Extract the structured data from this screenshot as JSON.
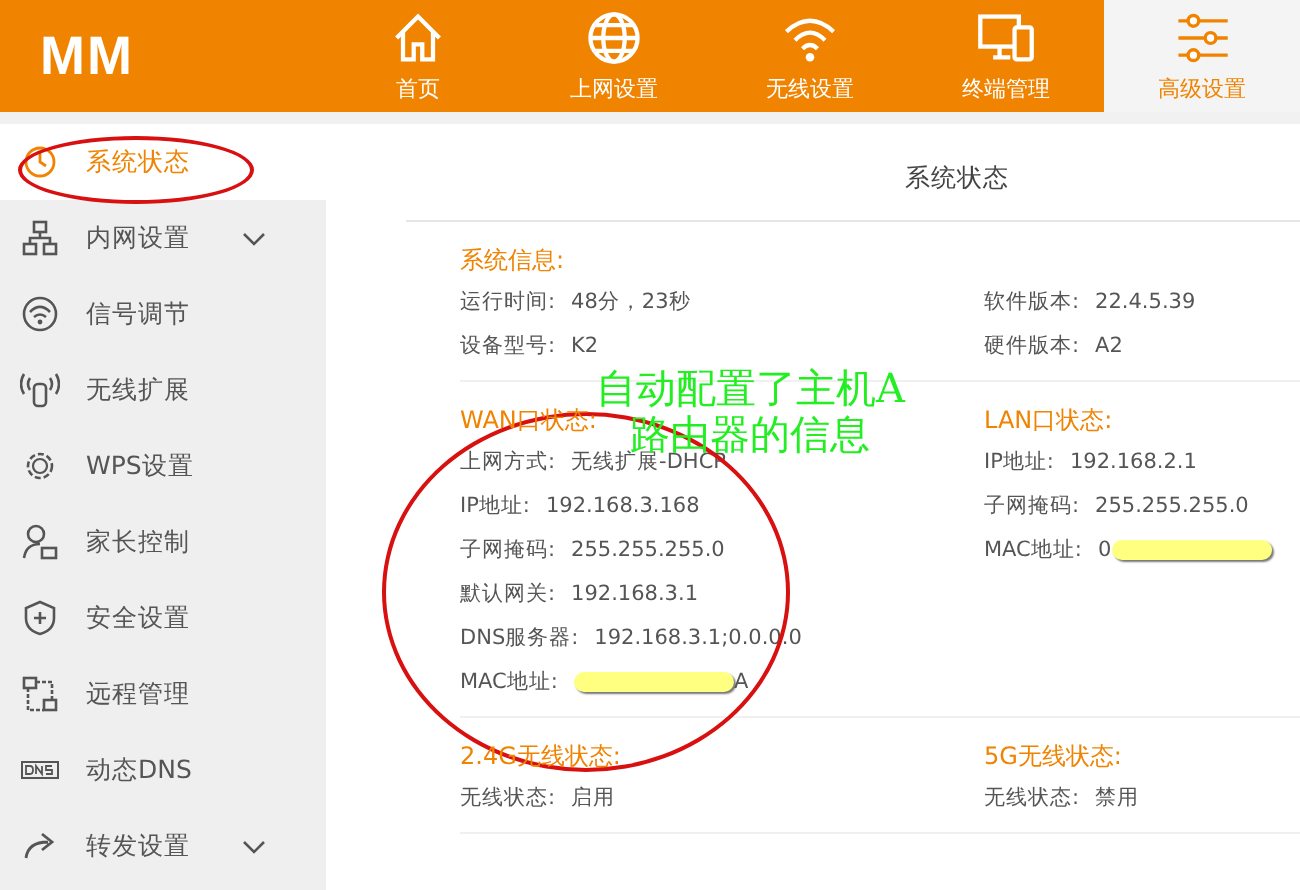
{
  "logo": "MM",
  "nav": [
    {
      "label": "首页",
      "selected": false
    },
    {
      "label": "上网设置",
      "selected": false
    },
    {
      "label": "无线设置",
      "selected": false
    },
    {
      "label": "终端管理",
      "selected": false
    },
    {
      "label": "高级设置",
      "selected": true
    }
  ],
  "sidebar": {
    "items": [
      {
        "label": "系统状态",
        "selected": true,
        "expandable": false
      },
      {
        "label": "内网设置",
        "selected": false,
        "expandable": true
      },
      {
        "label": "信号调节",
        "selected": false,
        "expandable": false
      },
      {
        "label": "无线扩展",
        "selected": false,
        "expandable": false
      },
      {
        "label": "WPS设置",
        "selected": false,
        "expandable": false
      },
      {
        "label": "家长控制",
        "selected": false,
        "expandable": false
      },
      {
        "label": "安全设置",
        "selected": false,
        "expandable": false
      },
      {
        "label": "远程管理",
        "selected": false,
        "expandable": false
      },
      {
        "label": "动态DNS",
        "selected": false,
        "expandable": false
      },
      {
        "label": "转发设置",
        "selected": false,
        "expandable": true
      }
    ]
  },
  "page_title": "系统状态",
  "sections": [
    {
      "columns": [
        {
          "heading": "系统信息:",
          "rows": [
            {
              "label": "运行时间:",
              "value": "48分，23秒"
            },
            {
              "label": "设备型号:",
              "value": "K2"
            }
          ]
        },
        {
          "rows": [
            {
              "label": "软件版本:",
              "value": "22.4.5.39"
            },
            {
              "label": "硬件版本:",
              "value": "A2"
            }
          ]
        }
      ]
    },
    {
      "columns": [
        {
          "heading": "WAN口状态:",
          "rows": [
            {
              "label": "上网方式:",
              "value": "无线扩展-DHCP"
            },
            {
              "label": "IP地址:",
              "value": "192.168.3.168"
            },
            {
              "label": "子网掩码:",
              "value": "255.255.255.0"
            },
            {
              "label": "默认网关:",
              "value": "192.168.3.1"
            },
            {
              "label": "DNS服务器:",
              "value": "192.168.3.1;0.0.0.0"
            },
            {
              "label": "MAC地址:",
              "value": "A",
              "kind": "headmasked"
            }
          ]
        },
        {
          "heading": "LAN口状态:",
          "rows": [
            {
              "label": "IP地址:",
              "value": "192.168.2.1"
            },
            {
              "label": "子网掩码:",
              "value": "255.255.255.0"
            },
            {
              "label": "MAC地址:",
              "value": "0",
              "kind": "tailmasked"
            }
          ]
        }
      ]
    },
    {
      "columns": [
        {
          "heading": "2.4G无线状态:",
          "rows": [
            {
              "label": "无线状态:",
              "value": "启用"
            }
          ]
        },
        {
          "heading": "5G无线状态:",
          "rows": [
            {
              "label": "无线状态:",
              "value": "禁用"
            }
          ]
        }
      ]
    }
  ],
  "annotation": {
    "lines": [
      "自动配置了主机A",
      "路由器的信息"
    ]
  }
}
